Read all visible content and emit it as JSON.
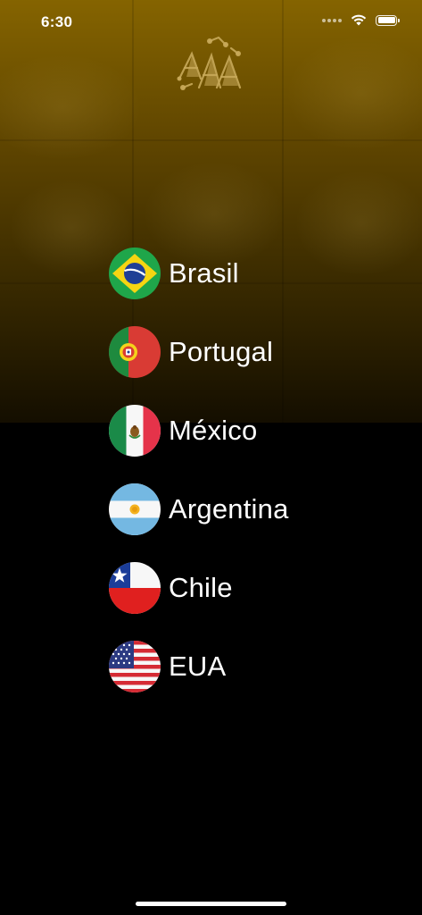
{
  "status_bar": {
    "time": "6:30",
    "icons": [
      "signal-icon",
      "wifi-icon",
      "battery-icon"
    ]
  },
  "hero": {
    "logo_icon": "app-logo-icon",
    "background_color": "#8c6900"
  },
  "countries": [
    {
      "label": "Brasil",
      "flag_icon": "brazil-flag-icon"
    },
    {
      "label": "Portugal",
      "flag_icon": "portugal-flag-icon"
    },
    {
      "label": "México",
      "flag_icon": "mexico-flag-icon"
    },
    {
      "label": "Argentina",
      "flag_icon": "argentina-flag-icon"
    },
    {
      "label": "Chile",
      "flag_icon": "chile-flag-icon"
    },
    {
      "label": "EUA",
      "flag_icon": "usa-flag-icon"
    }
  ]
}
